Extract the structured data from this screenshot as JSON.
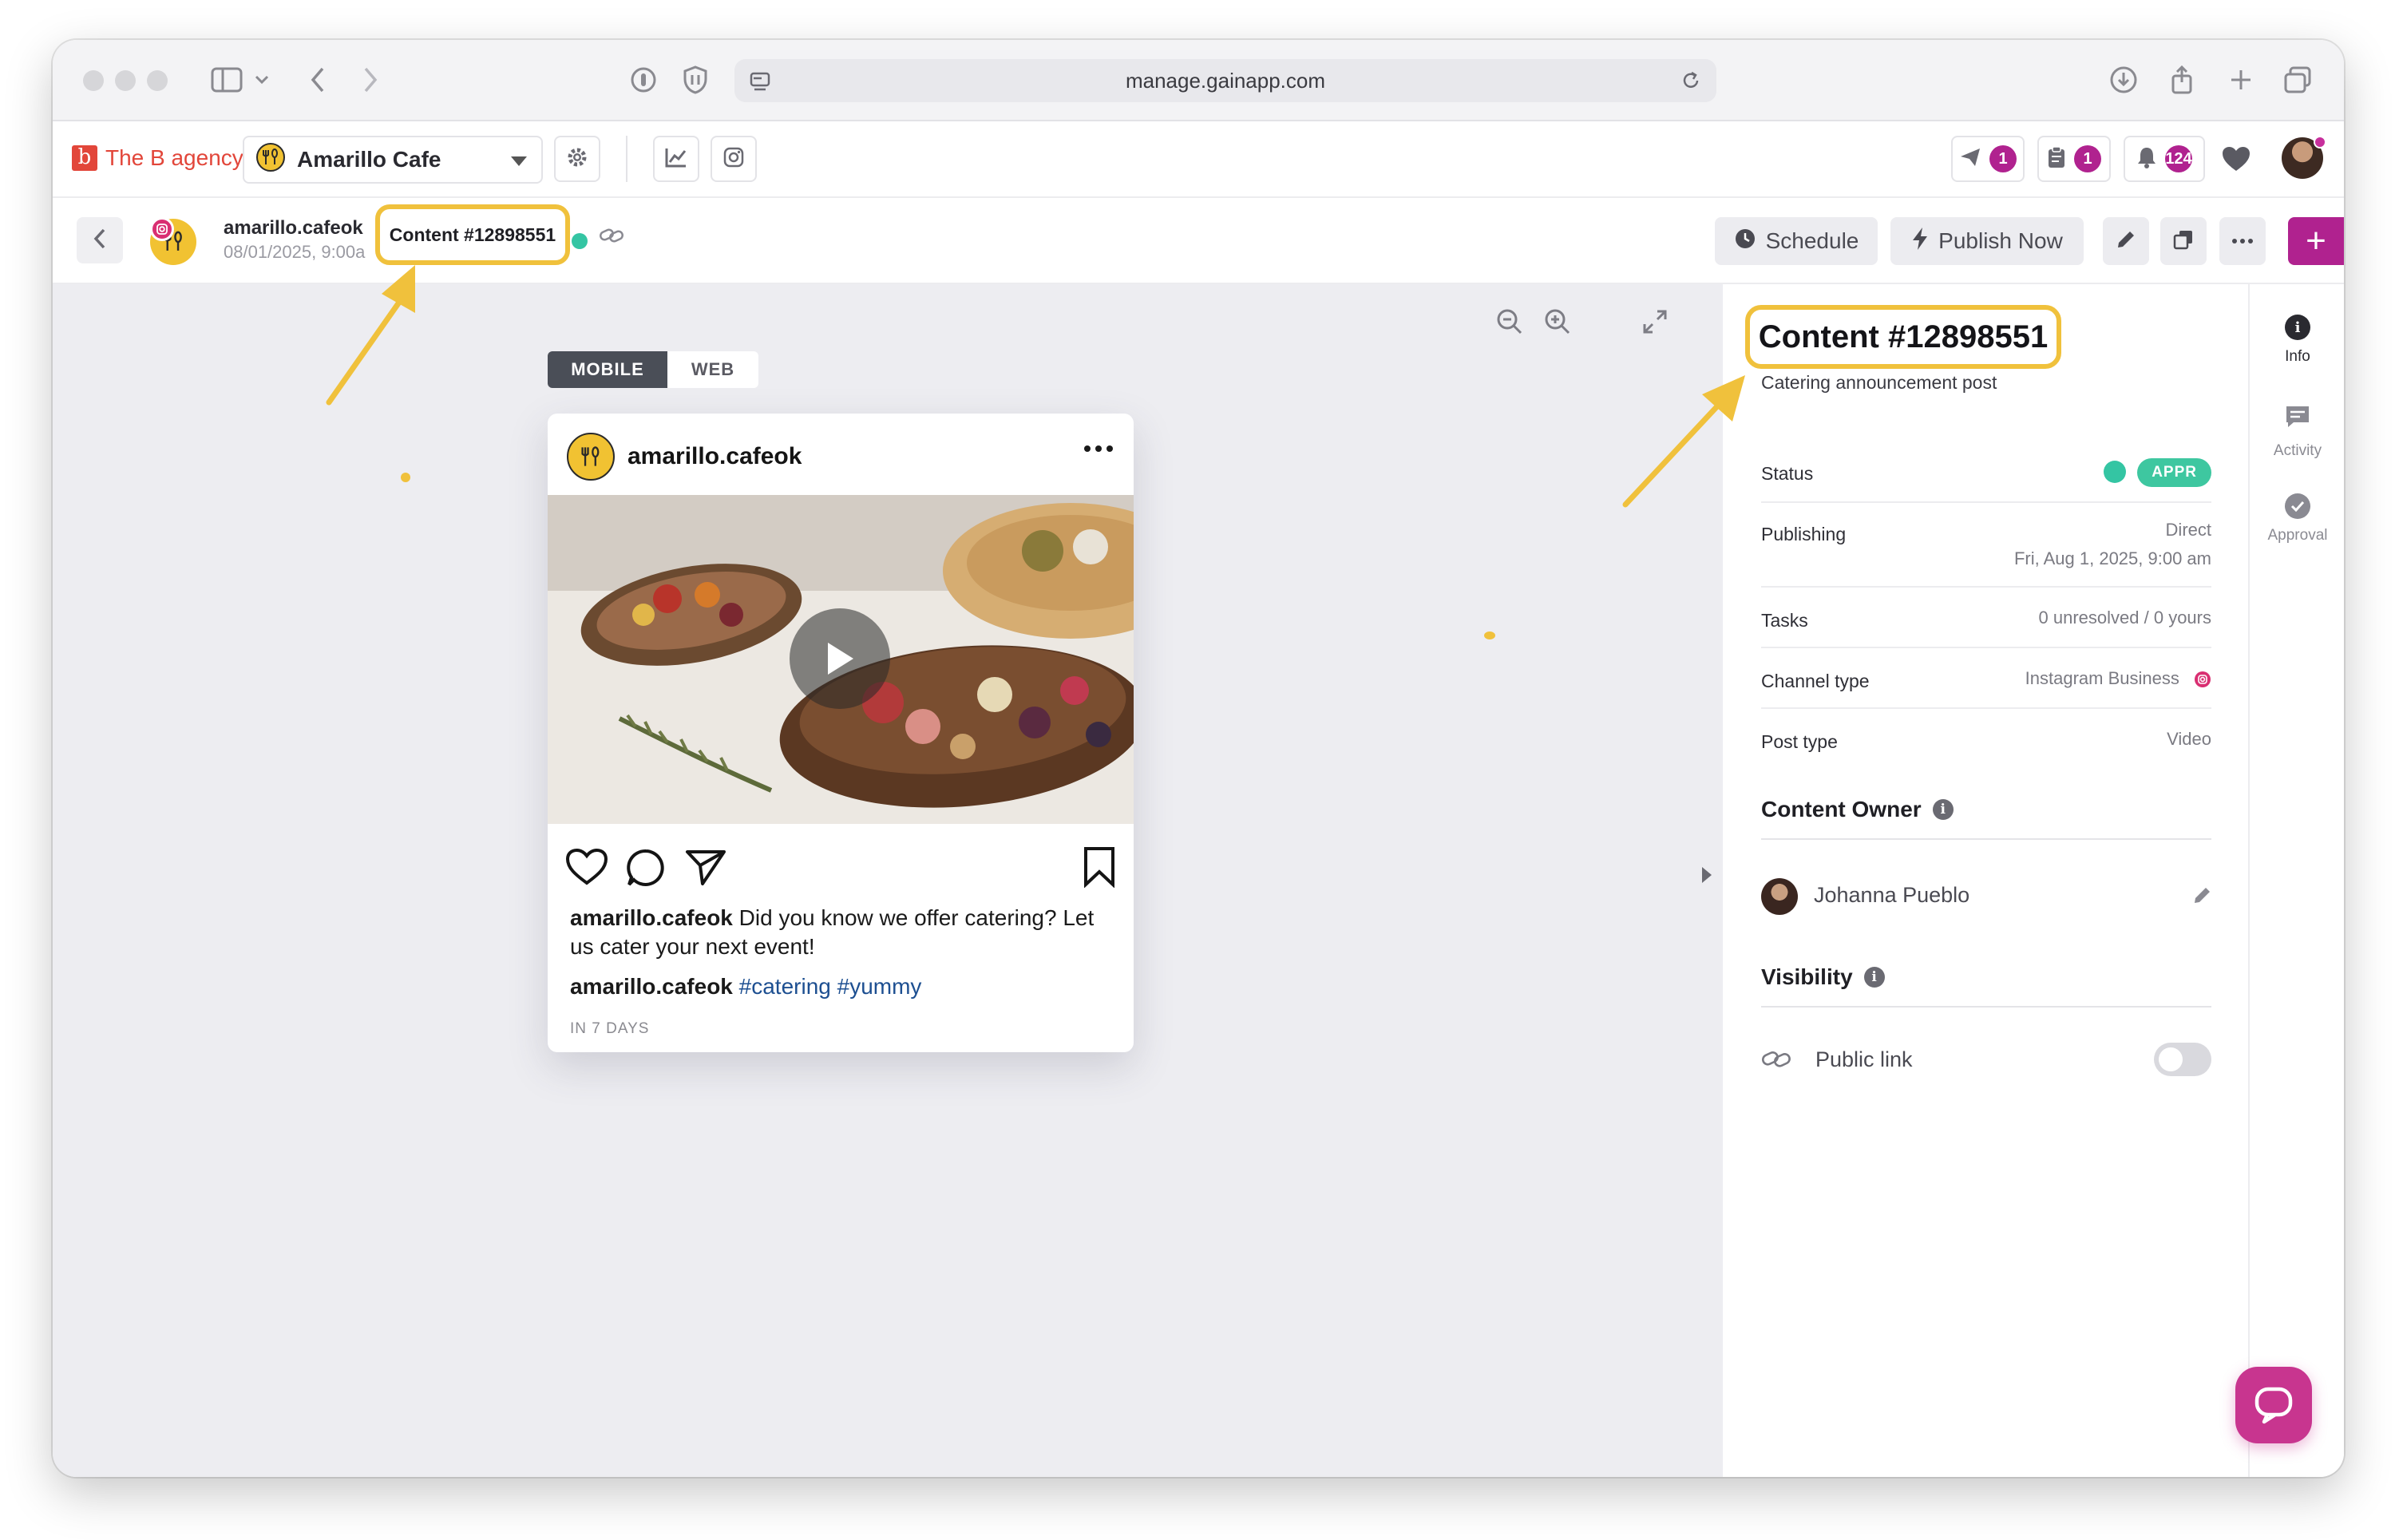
{
  "browser": {
    "url": "manage.gainapp.com"
  },
  "appbar": {
    "brand_logo": "b",
    "brand_name": "The B agency",
    "account_name": "Amarillo Cafe",
    "outbox_count": "1",
    "tasks_count": "1",
    "notifications_count": "124"
  },
  "subbar": {
    "handle": "amarillo.cafeok",
    "date": "08/01/2025, 9:00a",
    "content_id": "Content #12898551",
    "schedule_label": "Schedule",
    "publish_label": "Publish Now",
    "add_label": "+"
  },
  "preview": {
    "mobile_label": "MOBILE",
    "web_label": "WEB",
    "handle": "amarillo.cafeok",
    "caption_text": "Did you know we offer catering? Let us cater your next event!",
    "tags": [
      "#catering",
      "#yummy"
    ],
    "time_label": "IN 7 DAYS"
  },
  "panel": {
    "title": "Content #12898551",
    "subtitle": "Catering announcement post",
    "status_label": "Status",
    "status_value": "APPR",
    "publishing_label": "Publishing",
    "publishing_method": "Direct",
    "publishing_date": "Fri, Aug 1, 2025, 9:00 am",
    "tasks_label": "Tasks",
    "tasks_value": "0 unresolved / 0 yours",
    "channel_label": "Channel type",
    "channel_value": "Instagram Business",
    "post_type_label": "Post type",
    "post_type_value": "Video",
    "owner_title": "Content Owner",
    "owner_name": "Johanna Pueblo",
    "visibility_title": "Visibility",
    "public_link_label": "Public link",
    "public_link_enabled": false
  },
  "rail": {
    "info": "Info",
    "activity": "Activity",
    "approval": "Approval"
  },
  "colors": {
    "accent": "#b0228f",
    "highlight": "#f0c13c",
    "status_green": "#34c5a3",
    "brand_red": "#e2463a"
  }
}
